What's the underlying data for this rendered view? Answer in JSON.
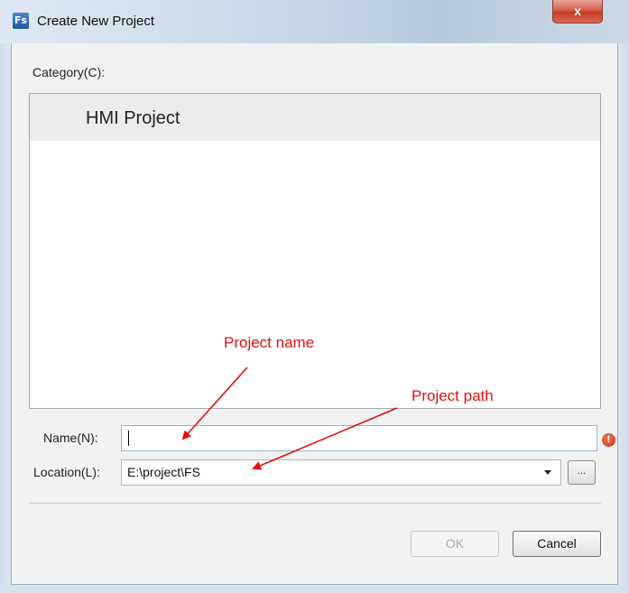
{
  "window": {
    "title": "Create New Project",
    "icon_text": "Fs",
    "close_glyph": "x"
  },
  "category": {
    "label": "Category(C):",
    "items": [
      {
        "label": "HMI Project",
        "selected": true
      }
    ]
  },
  "form": {
    "name_label": "Name(N):",
    "name_value": "",
    "location_label": "Location(L):",
    "location_value": "E:\\project\\FS",
    "browse_label": "...",
    "error_icon": "!"
  },
  "buttons": {
    "ok_label": "OK",
    "ok_enabled": false,
    "cancel_label": "Cancel"
  },
  "annotations": {
    "name_callout": "Project name",
    "path_callout": "Project path",
    "color": "#e01010"
  },
  "colors": {
    "client_bg": "#f2f2f2",
    "selected_item_bg": "#ececec",
    "title_gradient": "#c9d8e8",
    "close_button": "#c43b24"
  }
}
